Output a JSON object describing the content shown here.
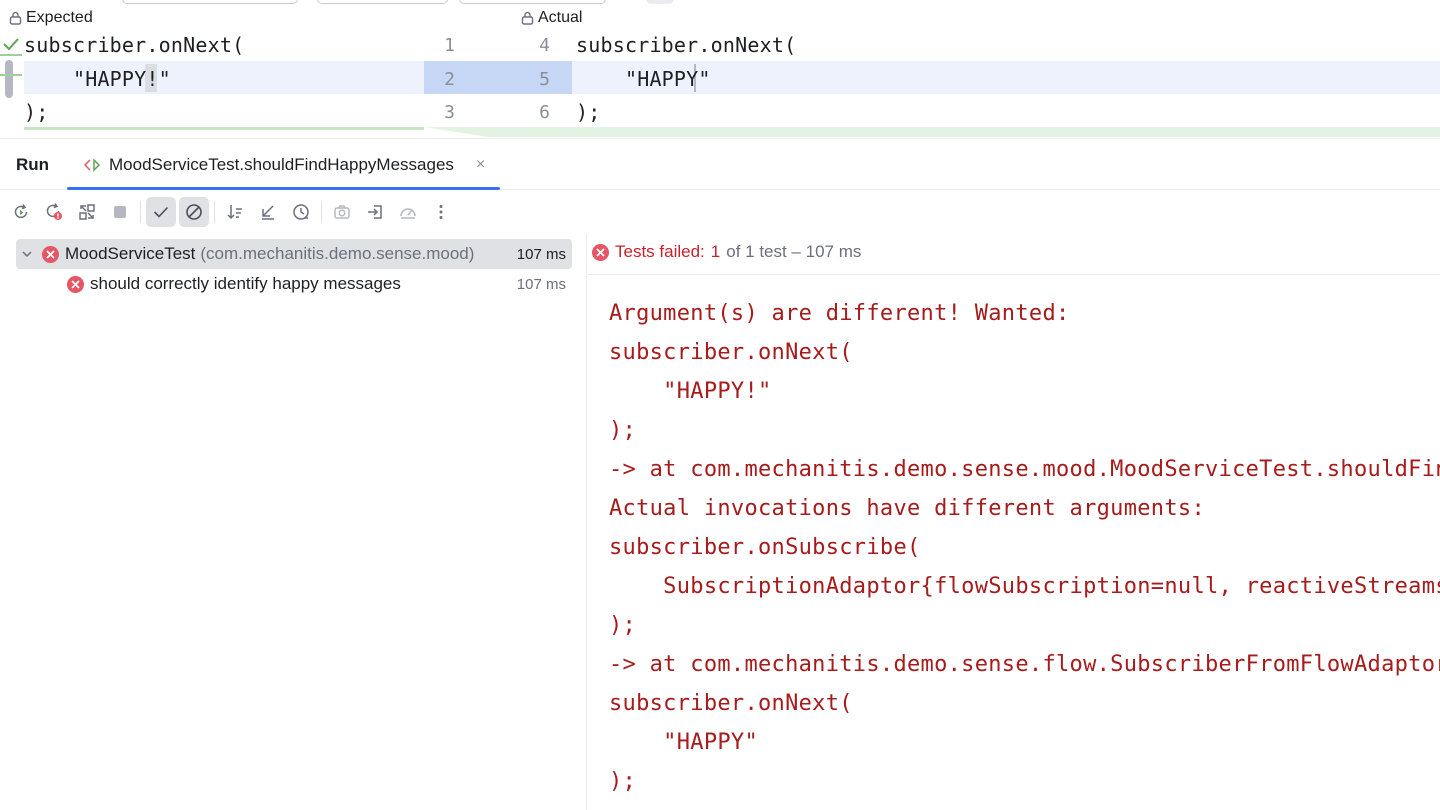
{
  "diff": {
    "expected_label": "Expected",
    "actual_label": "Actual",
    "left_lines": [
      {
        "num": "1",
        "text": "subscriber.onNext("
      },
      {
        "num": "2",
        "text": "    \"HAPPY!\""
      },
      {
        "num": "3",
        "text": ");"
      }
    ],
    "right_lines": [
      {
        "num": "4",
        "text": "subscriber.onNext("
      },
      {
        "num": "5",
        "text": "    \"HAPPY\""
      },
      {
        "num": "6",
        "text": ");"
      }
    ]
  },
  "run": {
    "title": "Run",
    "tab_label": "MoodServiceTest.shouldFindHappyMessages",
    "close_glyph": "×"
  },
  "tree": {
    "suite_name": "MoodServiceTest",
    "suite_package": "(com.mechanitis.demo.sense.mood)",
    "suite_time": "107 ms",
    "test_name": "should correctly identify happy messages",
    "test_time": "107 ms"
  },
  "status": {
    "prefix": "Tests failed:",
    "failed": "1",
    "rest": "of 1 test – 107 ms"
  },
  "console_lines": [
    "Argument(s) are different! Wanted:",
    "subscriber.onNext(",
    "    \"HAPPY!\"",
    ");",
    "-> at com.mechanitis.demo.sense.mood.MoodServiceTest.shouldFindHappyMessages",
    "Actual invocations have different arguments:",
    "subscriber.onSubscribe(",
    "    SubscriptionAdaptor{flowSubscription=null, reactiveStreamsSubscription",
    ");",
    "-> at com.mechanitis.demo.sense.flow.SubscriberFromFlowAdaptor",
    "subscriber.onNext(",
    "    \"HAPPY\"",
    ");"
  ],
  "colors": {
    "accent": "#3574f0",
    "error": "#e55765",
    "console_text": "#a61b1b"
  }
}
